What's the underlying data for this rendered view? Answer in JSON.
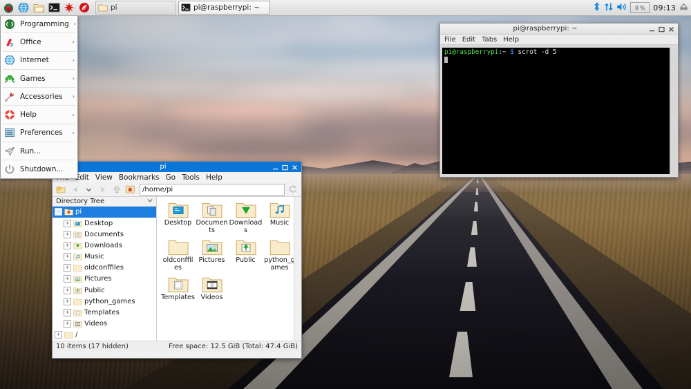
{
  "taskbar": {
    "launchers": [
      {
        "name": "raspberry-menu-icon",
        "label": "Menu"
      },
      {
        "name": "web-browser-icon",
        "label": "Web Browser"
      },
      {
        "name": "file-manager-icon",
        "label": "File Manager"
      },
      {
        "name": "terminal-icon",
        "label": "Terminal"
      },
      {
        "name": "mathematica-icon",
        "label": "Mathematica"
      },
      {
        "name": "wolfram-icon",
        "label": "Wolfram"
      }
    ],
    "windows": [
      {
        "name": "taskbar-window-filemanager",
        "label": "pi",
        "icon": "folder-icon",
        "active": false
      },
      {
        "name": "taskbar-window-terminal",
        "label": "pi@raspberrypi: ~",
        "icon": "terminal-icon",
        "active": true
      }
    ],
    "tray": {
      "bluetooth": "bluetooth-icon",
      "network": "network-icon",
      "volume": "volume-icon",
      "cpu_label": "0 %",
      "clock": "09:13",
      "eject": "eject-icon"
    }
  },
  "menu": {
    "items": [
      {
        "label": "Programming",
        "icon": "programming-icon",
        "submenu": true
      },
      {
        "label": "Office",
        "icon": "office-icon",
        "submenu": true
      },
      {
        "label": "Internet",
        "icon": "internet-icon",
        "submenu": true
      },
      {
        "label": "Games",
        "icon": "games-icon",
        "submenu": true
      },
      {
        "label": "Accessories",
        "icon": "accessories-icon",
        "submenu": true
      },
      {
        "label": "Help",
        "icon": "help-icon",
        "submenu": true
      },
      {
        "label": "Preferences",
        "icon": "preferences-icon",
        "submenu": true
      },
      {
        "label": "Run...",
        "icon": "run-icon",
        "submenu": false
      },
      {
        "label": "Shutdown...",
        "icon": "shutdown-icon",
        "submenu": false
      }
    ],
    "arrow": "›"
  },
  "terminal": {
    "title": "pi@raspberrypi: ~",
    "menus": [
      "File",
      "Edit",
      "Tabs",
      "Help"
    ],
    "prompt_user": "pi@raspberrypi",
    "prompt_path": ":~",
    "prompt_sym": "$",
    "command": "scrot -d 5"
  },
  "filemanager": {
    "title": "pi",
    "menus": [
      "File",
      "Edit",
      "View",
      "Bookmarks",
      "Go",
      "Tools",
      "Help"
    ],
    "path": "/home/pi",
    "tree_header": "Directory Tree",
    "tree": [
      {
        "label": "pi",
        "icon": "home-folder-icon",
        "depth": 0,
        "selected": true,
        "expander": "-"
      },
      {
        "label": "Desktop",
        "icon": "desktop-folder-icon",
        "depth": 1,
        "selected": false,
        "expander": "+"
      },
      {
        "label": "Documents",
        "icon": "documents-folder-icon",
        "depth": 1,
        "selected": false,
        "expander": "+"
      },
      {
        "label": "Downloads",
        "icon": "downloads-folder-icon",
        "depth": 1,
        "selected": false,
        "expander": "+"
      },
      {
        "label": "Music",
        "icon": "music-folder-icon",
        "depth": 1,
        "selected": false,
        "expander": "+"
      },
      {
        "label": "oldconffiles",
        "icon": "plain-folder-icon",
        "depth": 1,
        "selected": false,
        "expander": "+"
      },
      {
        "label": "Pictures",
        "icon": "pictures-folder-icon",
        "depth": 1,
        "selected": false,
        "expander": "+"
      },
      {
        "label": "Public",
        "icon": "public-folder-icon",
        "depth": 1,
        "selected": false,
        "expander": "+"
      },
      {
        "label": "python_games",
        "icon": "plain-folder-icon",
        "depth": 1,
        "selected": false,
        "expander": "+"
      },
      {
        "label": "Templates",
        "icon": "templates-folder-icon",
        "depth": 1,
        "selected": false,
        "expander": "+"
      },
      {
        "label": "Videos",
        "icon": "videos-folder-icon",
        "depth": 1,
        "selected": false,
        "expander": "+"
      },
      {
        "label": "/",
        "icon": "root-folder-icon",
        "depth": 0,
        "selected": false,
        "expander": "+"
      }
    ],
    "files": [
      {
        "label": "Desktop",
        "icon": "desktop-folder-icon"
      },
      {
        "label": "Documents",
        "icon": "documents-folder-icon"
      },
      {
        "label": "Downloads",
        "icon": "downloads-folder-icon"
      },
      {
        "label": "Music",
        "icon": "music-folder-icon"
      },
      {
        "label": "oldconffiles",
        "icon": "plain-folder-icon"
      },
      {
        "label": "Pictures",
        "icon": "pictures-folder-icon"
      },
      {
        "label": "Public",
        "icon": "public-folder-icon"
      },
      {
        "label": "python_games",
        "icon": "plain-folder-icon"
      },
      {
        "label": "Templates",
        "icon": "templates-folder-icon"
      },
      {
        "label": "Videos",
        "icon": "videos-folder-icon"
      }
    ],
    "status_items": "10 items (17 hidden)",
    "status_space": "Free space: 12.5 GiB (Total: 47.4 GiB)"
  },
  "window_buttons": {
    "minimize": "minimize-icon",
    "maximize": "maximize-icon",
    "close": "close-icon"
  },
  "colors": {
    "titlebar_active": "#0c76d8",
    "tree_selection": "#1c7fe0",
    "terminal_bg": "#000000",
    "prompt_green": "#4ee24e",
    "prompt_blue": "#4f8fff",
    "taskbar_bg": "#e3e3e3"
  }
}
